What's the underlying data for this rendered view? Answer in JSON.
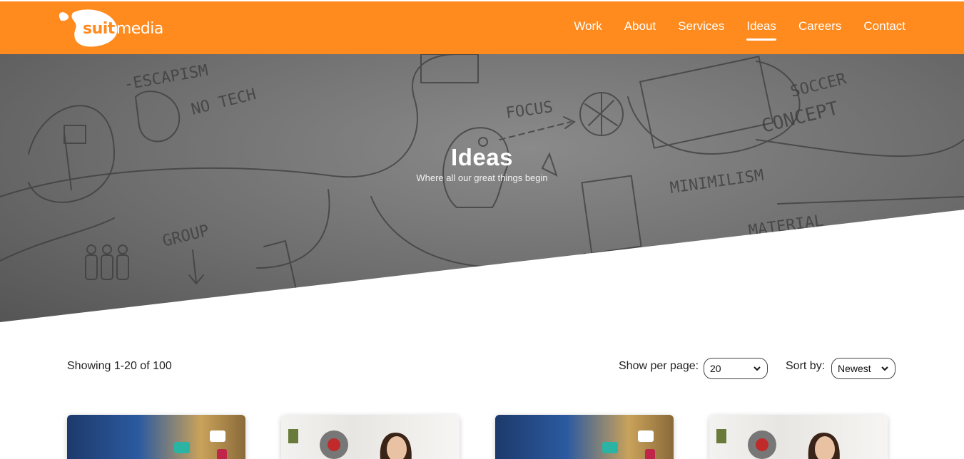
{
  "header": {
    "logo": {
      "text_brand": "suit",
      "text_rest": "media"
    },
    "nav": [
      {
        "label": "Work",
        "active": false
      },
      {
        "label": "About",
        "active": false
      },
      {
        "label": "Services",
        "active": false
      },
      {
        "label": "Ideas",
        "active": true
      },
      {
        "label": "Careers",
        "active": false
      },
      {
        "label": "Contact",
        "active": false
      }
    ]
  },
  "hero": {
    "title": "Ideas",
    "subtitle": "Where all our great things begin"
  },
  "controls": {
    "showing": "Showing 1-20 of 100",
    "per_page_label": "Show per page:",
    "per_page_value": "20",
    "sort_label": "Sort by:",
    "sort_value": "Newest"
  },
  "cards": [
    {
      "image": "tech-abstract"
    },
    {
      "image": "woman-with-microphone"
    },
    {
      "image": "tech-abstract"
    },
    {
      "image": "woman-with-microphone"
    }
  ],
  "colors": {
    "brand_orange": "#ff8a1d"
  }
}
